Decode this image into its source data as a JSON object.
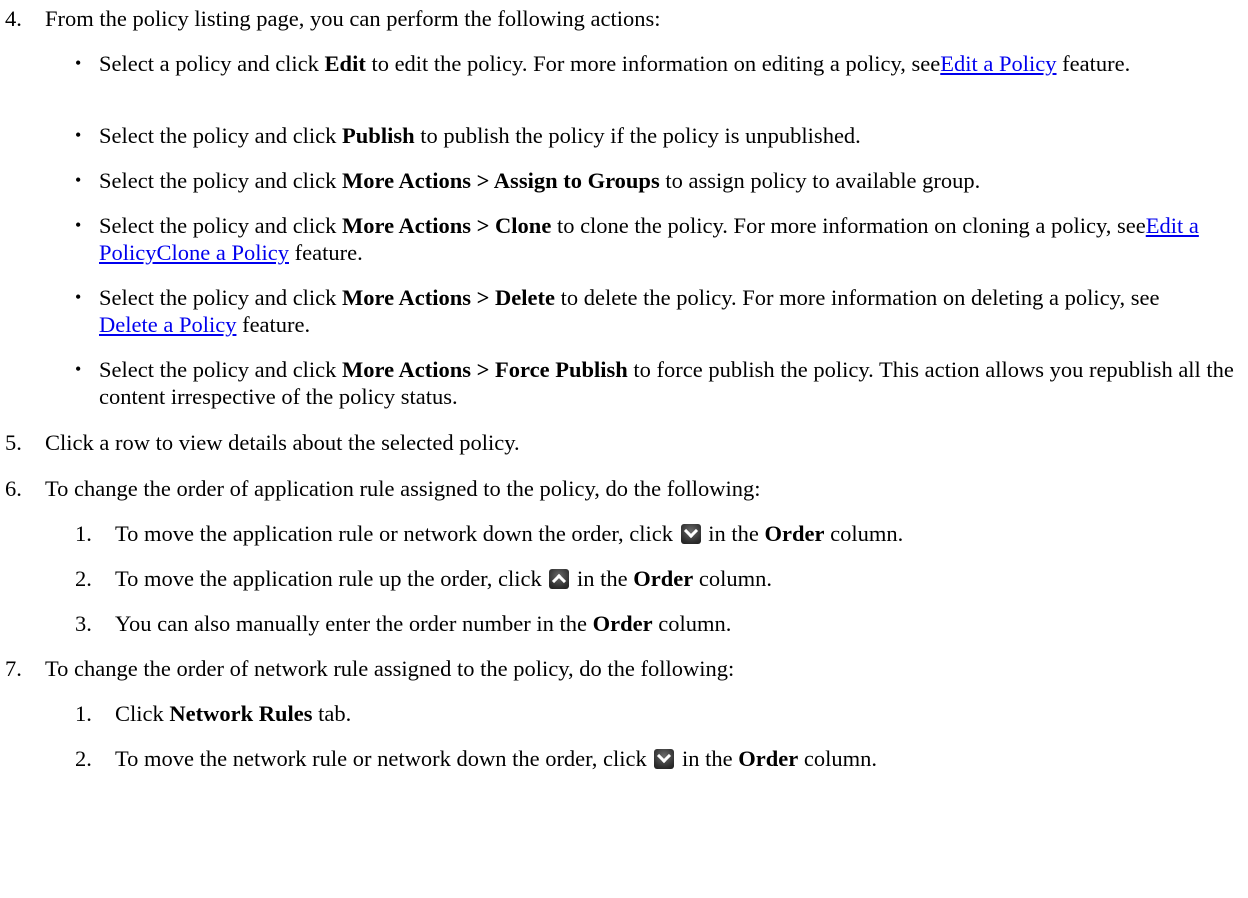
{
  "step4": {
    "num": "4.",
    "text": "From the policy listing page, you can perform the following actions:",
    "bullets": [
      {
        "pre": "Select a policy and click ",
        "bold": "Edit",
        "mid": " to edit the policy. For more information on editing a policy, see",
        "link": "Edit a Policy",
        "post": " feature."
      },
      {
        "pre": "Select the policy and click ",
        "bold": "Publish",
        "post": " to publish the policy if the policy is unpublished."
      },
      {
        "pre": "Select the policy and click ",
        "bold": "More Actions > Assign to Groups",
        "post": " to assign policy to available group."
      },
      {
        "pre": "Select the policy and click ",
        "bold": "More Actions > Clone",
        "mid": " to clone the policy. For more information on cloning a policy, see",
        "link": "Edit a PolicyClone a Policy",
        "post": " feature."
      },
      {
        "pre": "Select the policy and click ",
        "bold": "More Actions > Delete",
        "mid": " to delete the policy. For more information on deleting a policy, see ",
        "link": "Delete a Policy",
        "post": " feature."
      },
      {
        "pre": "Select the policy and click ",
        "bold": "More Actions > Force Publish",
        "post": " to force publish the policy. This action allows you republish all the content irrespective of the policy status."
      }
    ]
  },
  "step5": {
    "num": "5.",
    "text": "Click a row to view details about the selected policy."
  },
  "step6": {
    "num": "6.",
    "text": "To change the order of application rule assigned to the policy, do the following:",
    "items": [
      {
        "num": "1.",
        "pre": "To move the application rule or network down the order, click ",
        "icon": "chevron-down-icon",
        "mid": " in the ",
        "bold": "Order",
        "post": " column."
      },
      {
        "num": "2.",
        "pre": "To move the application rule up the order, click ",
        "icon": "chevron-up-icon",
        "mid": " in the ",
        "bold": "Order",
        "post": " column."
      },
      {
        "num": "3.",
        "pre": "You can also manually enter the order number in the ",
        "bold": "Order",
        "post": " column."
      }
    ]
  },
  "step7": {
    "num": "7.",
    "text": "To change the order of network rule assigned to the policy, do the following:",
    "items": [
      {
        "num": "1.",
        "pre": "Click ",
        "bold": "Network Rules",
        "post": " tab."
      },
      {
        "num": "2.",
        "pre": "To move the network rule or network down the order, click ",
        "icon": "chevron-down-icon",
        "mid": " in the ",
        "bold": "Order",
        "post": " column."
      }
    ]
  }
}
